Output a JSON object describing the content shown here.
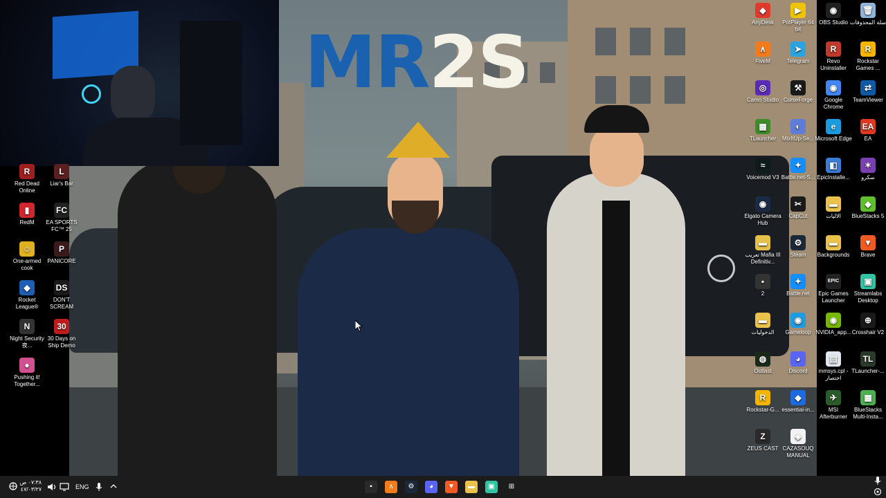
{
  "wallpaper": {
    "brand_text_a": "MR",
    "brand_text_b": "2S",
    "brand_color_a": "#1a62b0",
    "brand_color_b": "#f5f2e8"
  },
  "left_icons": [
    {
      "name": "red-dead-online",
      "label": "Red Dead Online",
      "color": "#a11e1e",
      "glyph": "R"
    },
    {
      "name": "liars-bar",
      "label": "Liar's Bar",
      "color": "#5a2020",
      "glyph": "L"
    },
    {
      "name": "redm",
      "label": "RedM",
      "color": "#d0262c",
      "glyph": "▮"
    },
    {
      "name": "ea-sports-fc-25",
      "label": "EA SPORTS FC™ 25",
      "color": "#222",
      "glyph": "FC"
    },
    {
      "name": "one-armed-cook",
      "label": "One-armed cook",
      "color": "#e0b020",
      "glyph": "☺"
    },
    {
      "name": "panicore",
      "label": "PANICORE",
      "color": "#3a1a1a",
      "glyph": "P"
    },
    {
      "name": "rocket-league",
      "label": "Rocket League®",
      "color": "#1e5fb5",
      "glyph": "◆"
    },
    {
      "name": "dont-scream",
      "label": "DON'T SCREAM",
      "color": "#1a1a1a",
      "glyph": "DS"
    },
    {
      "name": "night-security",
      "label": "Night Security 夜...",
      "color": "#333",
      "glyph": "N"
    },
    {
      "name": "30-days-on-ship",
      "label": "30 Days on Ship Demo",
      "color": "#c01c1c",
      "glyph": "30"
    },
    {
      "name": "pushing-it-together",
      "label": "Pushing it! Together...",
      "color": "#d05090",
      "glyph": "●"
    }
  ],
  "right_icons": [
    {
      "name": "anydesk",
      "label": "AnyDesk",
      "color": "#e03a2e",
      "glyph": "◆"
    },
    {
      "name": "potplayer",
      "label": "PotPlayer 64 bit",
      "color": "#f0c400",
      "glyph": "▶"
    },
    {
      "name": "obs-studio",
      "label": "OBS Studio",
      "color": "#202020",
      "glyph": "◉"
    },
    {
      "name": "recycle-bin",
      "label": "سلة المحذوفات",
      "color": "#8fb3d9",
      "glyph": "🗑"
    },
    {
      "name": "fivem",
      "label": "FiveM",
      "color": "#f27b1c",
      "glyph": "∧"
    },
    {
      "name": "telegram",
      "label": "Telegram",
      "color": "#2aa3df",
      "glyph": "➤"
    },
    {
      "name": "revo-uninstaller",
      "label": "Revo Uninstaller",
      "color": "#c0392b",
      "glyph": "R"
    },
    {
      "name": "rockstar-games",
      "label": "Rockstar Games ...",
      "color": "#f5b400",
      "glyph": "R"
    },
    {
      "name": "camo-studio",
      "label": "Camo Studio",
      "color": "#5b2bb5",
      "glyph": "◎"
    },
    {
      "name": "curseforge",
      "label": "CurseForge",
      "color": "#1a1a1a",
      "glyph": "⚒"
    },
    {
      "name": "google-chrome",
      "label": "Google Chrome",
      "color": "#4285f4",
      "glyph": "◉"
    },
    {
      "name": "teamviewer",
      "label": "TeamViewer",
      "color": "#0e5aa7",
      "glyph": "⇄"
    },
    {
      "name": "tlauncher-1",
      "label": "TLauncher",
      "color": "#3d8b2b",
      "glyph": "▦"
    },
    {
      "name": "mixitup",
      "label": "MixItUp-Se...",
      "color": "#5f7dd8",
      "glyph": "◐"
    },
    {
      "name": "microsoft-edge",
      "label": "Microsoft Edge",
      "color": "#1a9be0",
      "glyph": "e"
    },
    {
      "name": "ea",
      "label": "EA",
      "color": "#e0391f",
      "glyph": "EA"
    },
    {
      "name": "voicemod",
      "label": "Voicemod V3",
      "color": "#0d1b1b",
      "glyph": "≈"
    },
    {
      "name": "battle-net-setup",
      "label": "Battle.net-S...",
      "color": "#148eff",
      "glyph": "✦"
    },
    {
      "name": "epic-installer",
      "label": "EpicInstalle...",
      "color": "#3a7bd5",
      "glyph": "◧"
    },
    {
      "name": "sakro",
      "label": "سكرو",
      "color": "#7a3fb0",
      "glyph": "✶"
    },
    {
      "name": "elgato-camera-hub",
      "label": "Elgato Camera Hub",
      "color": "#1b2a44",
      "glyph": "◉"
    },
    {
      "name": "capcut",
      "label": "CapCut",
      "color": "#1a1a1a",
      "glyph": "✂"
    },
    {
      "name": "al-alliyat",
      "label": "الاليات",
      "color": "#e9c14b",
      "glyph": "▬"
    },
    {
      "name": "bluestacks-5",
      "label": "BlueStacks 5",
      "color": "#5fbf2c",
      "glyph": "◆"
    },
    {
      "name": "mafia-3",
      "label": "تعريب Mafia III Definitiv...",
      "color": "#e6c14a",
      "glyph": "▬"
    },
    {
      "name": "steam",
      "label": "Steam",
      "color": "#1b2838",
      "glyph": "⚙"
    },
    {
      "name": "backgrounds",
      "label": "Backgrounds",
      "color": "#e9c14b",
      "glyph": "▬"
    },
    {
      "name": "brave",
      "label": "Brave",
      "color": "#f15a22",
      "glyph": "▼"
    },
    {
      "name": "folder-2",
      "label": "2",
      "color": "#333",
      "glyph": "▪"
    },
    {
      "name": "battle-net",
      "label": "Battle.net",
      "color": "#148eff",
      "glyph": "✦"
    },
    {
      "name": "epic-games-launcher",
      "label": "Epic Games Launcher",
      "color": "#222",
      "glyph": "EPIC"
    },
    {
      "name": "streamlabs-desktop",
      "label": "Streamlabs Desktop",
      "color": "#31c3a2",
      "glyph": "▣"
    },
    {
      "name": "al-dakhiliyat",
      "label": "الدخوليات",
      "color": "#e9c14b",
      "glyph": "▬"
    },
    {
      "name": "gameloop",
      "label": "Gameloop",
      "color": "#1f9be0",
      "glyph": "◉"
    },
    {
      "name": "nvidia-app",
      "label": "NVIDIA_app...",
      "color": "#76b900",
      "glyph": "◉"
    },
    {
      "name": "crosshair-v2",
      "label": "Crosshair V2",
      "color": "#1a1a1a",
      "glyph": "⊕"
    },
    {
      "name": "outlast",
      "label": "Outlast",
      "color": "#1a2a1a",
      "glyph": "◍"
    },
    {
      "name": "discord",
      "label": "Discord",
      "color": "#5865f2",
      "glyph": "◕"
    },
    {
      "name": "mmsys-shortcut",
      "label": "mmsys.cpl - اختصار",
      "color": "#dfe6ee",
      "glyph": "▤"
    },
    {
      "name": "tlauncher-2",
      "label": "TLauncher-...",
      "color": "#2a3a2a",
      "glyph": "TL"
    },
    {
      "name": "rockstar-g-setup",
      "label": "Rockstar-G...",
      "color": "#f5b400",
      "glyph": "R"
    },
    {
      "name": "essential-in",
      "label": "essential-in...",
      "color": "#1d6be0",
      "glyph": "◆"
    },
    {
      "name": "msi-afterburner",
      "label": "MSI Afterburner",
      "color": "#2b5a2b",
      "glyph": "✈"
    },
    {
      "name": "bluestacks-multi",
      "label": "BlueStacks Multi-Insta...",
      "color": "#4caf50",
      "glyph": "▦"
    },
    {
      "name": "zeus-cast",
      "label": "ZEUS CAST",
      "color": "#2a2a2a",
      "glyph": "Z"
    },
    {
      "name": "cazasouq-manual",
      "label": "CAZASOUQ MANUAL",
      "color": "#f2f2f2",
      "glyph": "◈"
    }
  ],
  "taskbar": {
    "time": "٠٧:٣٨ ص",
    "date": "٤٧/٠٣/٢٧",
    "language": "ENG",
    "apps": [
      {
        "name": "app-terminal",
        "glyph": "▪",
        "color": "#2a2a2a"
      },
      {
        "name": "app-fivem",
        "glyph": "∧",
        "color": "#f27b1c"
      },
      {
        "name": "app-steam",
        "glyph": "⚙",
        "color": "#1b2838"
      },
      {
        "name": "app-discord",
        "glyph": "◕",
        "color": "#5865f2"
      },
      {
        "name": "app-brave",
        "glyph": "▼",
        "color": "#f15a22"
      },
      {
        "name": "app-file-explorer",
        "glyph": "▬",
        "color": "#e9c14b"
      },
      {
        "name": "app-streamlabs",
        "glyph": "▣",
        "color": "#31c3a2"
      },
      {
        "name": "app-start",
        "glyph": "⊞",
        "color": "#1c1c1c"
      }
    ]
  }
}
